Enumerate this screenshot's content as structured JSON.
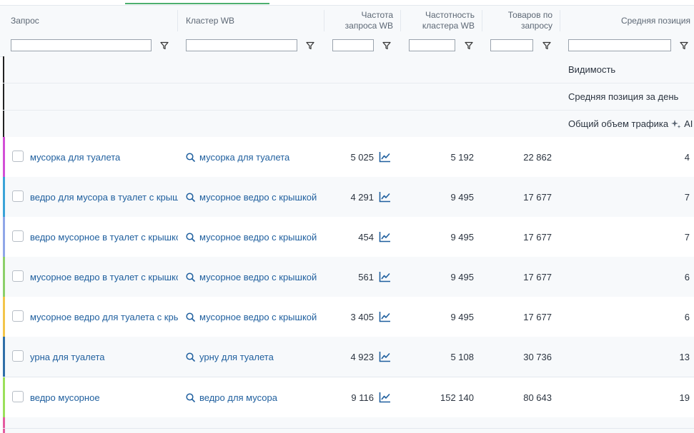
{
  "columns": {
    "query": "Запрос",
    "cluster": "Кластер WB",
    "freq_line1": "Частота",
    "freq_line2": "запроса WB",
    "cfreq_line1": "Частотность",
    "cfreq_line2": "кластера WB",
    "goods_line1": "Товаров по",
    "goods_line2": "запросу",
    "avgpos": "Средняя позиция"
  },
  "aggregates": {
    "visibility": "Видимость",
    "avg_pos_day": "Средняя позиция за день",
    "total_traffic": "Общий объем трафика",
    "ai_label": "AI"
  },
  "rows": [
    {
      "color": "#d24fd6",
      "query": "мусорка для туалета",
      "cluster": "мусорка для туалета",
      "freq": "5 025",
      "cluster_freq": "5 192",
      "goods": "22 862",
      "pos": "4"
    },
    {
      "color": "#3aa3d8",
      "query": "ведро для мусора в туалет с крышкой",
      "cluster": "мусорное ведро с крышкой",
      "freq": "4 291",
      "cluster_freq": "9 495",
      "goods": "17 677",
      "pos": "7"
    },
    {
      "color": "#8fa6e8",
      "query": "ведро мусорное в туалет с крышкой",
      "cluster": "мусорное ведро с крышкой",
      "freq": "454",
      "cluster_freq": "9 495",
      "goods": "17 677",
      "pos": "7"
    },
    {
      "color": "#8ccf6a",
      "query": "мусорное ведро в туалет с крышкой",
      "cluster": "мусорное ведро с крышкой",
      "freq": "561",
      "cluster_freq": "9 495",
      "goods": "17 677",
      "pos": "6"
    },
    {
      "color": "#f3c54a",
      "query": "мусорное ведро для туалета с крышкой",
      "cluster": "мусорное ведро с крышкой",
      "freq": "3 405",
      "cluster_freq": "9 495",
      "goods": "17 677",
      "pos": "6"
    },
    {
      "color": "#2f6fa8",
      "query": "урна для туалета",
      "cluster": "урну для туалета",
      "freq": "4 923",
      "cluster_freq": "5 108",
      "goods": "30 736",
      "pos": "13"
    },
    {
      "color": "#9be05a",
      "query": "ведро мусорное",
      "cluster": "ведро для мусора",
      "freq": "9 116",
      "cluster_freq": "152 140",
      "goods": "80 643",
      "pos": "19"
    }
  ],
  "colors": {
    "link": "#1f5f9e",
    "accent": "#4caf6e"
  }
}
